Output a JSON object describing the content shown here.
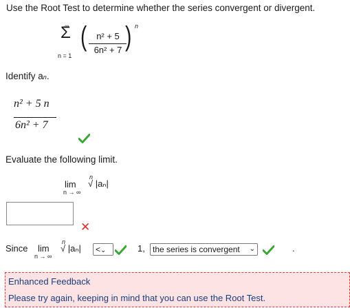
{
  "question": {
    "prompt": "Use the Root Test to determine whether the series convergent or divergent."
  },
  "series": {
    "sum_symbol": "Σ",
    "upper_limit": "∞",
    "lower_limit": "n = 1",
    "numerator": "n² + 5",
    "denominator": "6n² + 7",
    "exponent": "n"
  },
  "identify": {
    "label": "Identify a",
    "subscript": "n",
    "period": ".",
    "answer_numerator": "n² + 5 n",
    "answer_denominator": "6n² + 7"
  },
  "evaluate": {
    "label": "Evaluate the following limit.",
    "lim": "lim",
    "lim_sub": "n → ∞",
    "root_index": "n",
    "root_expr": "√ |aₙ|",
    "answer_value": ""
  },
  "since_row": {
    "since_label": "Since",
    "lim": "lim",
    "lim_sub": "n → ∞",
    "root_index": "n",
    "root_expr": "√ |aₙ|",
    "comparison_selected": "<",
    "chevron": "⌄",
    "value": "1,",
    "conclusion_selected": "the series is convergent",
    "end_mark": "."
  },
  "feedback": {
    "title": "Enhanced Feedback",
    "text": "Please try again, keeping in mind that you can use the Root Test."
  },
  "colors": {
    "check_green": "#3aa635",
    "error_red": "#d93025",
    "feedback_bg": "#fde3e3",
    "feedback_text": "#1a3e7a"
  }
}
